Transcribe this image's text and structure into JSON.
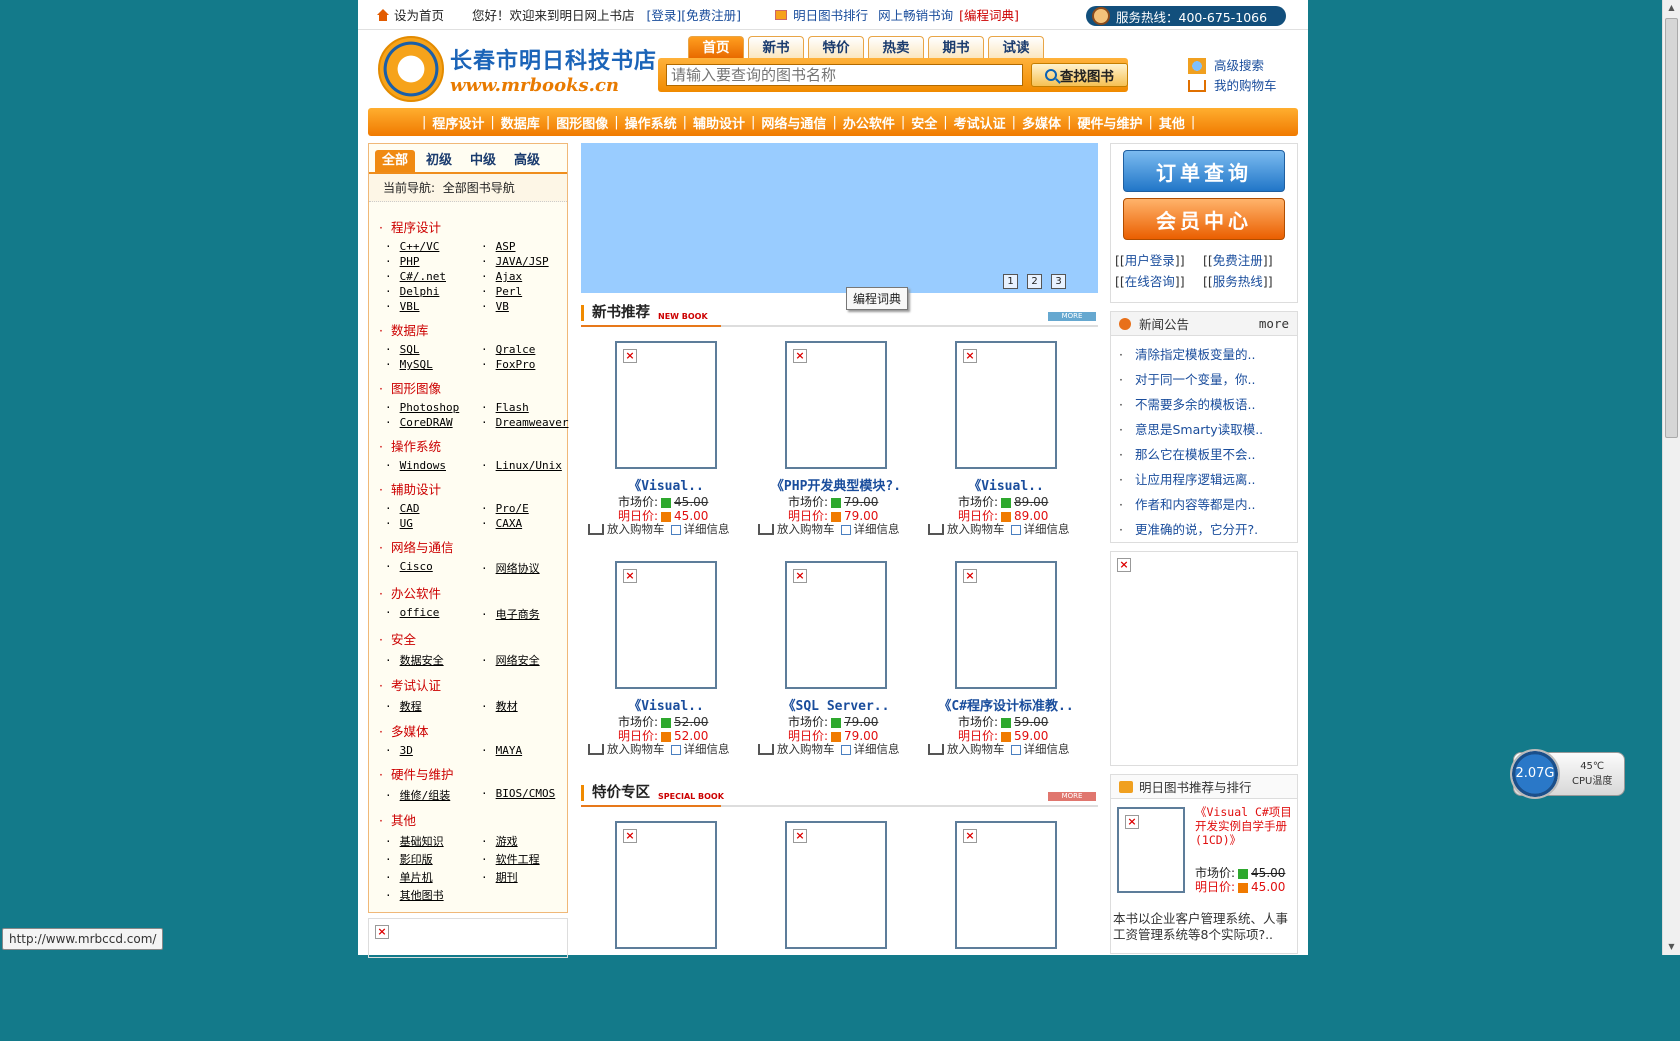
{
  "topbar": {
    "set_home": "设为首页",
    "welcome": "您好！欢迎来到明日网上书店",
    "login": "[登录]",
    "register": "[免费注册]",
    "ranking": "明日图书排行",
    "bestseller": "网上畅销书询",
    "dictionary": "[编程词典]",
    "hotline": "服务热线：400-675-1066"
  },
  "logo": {
    "name": "长春市明日科技书店",
    "url": "www.mrbooks.cn"
  },
  "nav_tabs": [
    "首页",
    "新书",
    "特价",
    "热卖",
    "期书",
    "试读"
  ],
  "search": {
    "placeholder": "请输入要查询的图书名称",
    "button": "查找图书"
  },
  "head_links": {
    "advanced": "高级搜索",
    "cart": "我的购物车"
  },
  "categories_bar": [
    "程序设计",
    "数据库",
    "图形图像",
    "操作系统",
    "辅助设计",
    "网络与通信",
    "办公软件",
    "安全",
    "考试认证",
    "多媒体",
    "硬件与维护",
    "其他"
  ],
  "left": {
    "levels": [
      "全部",
      "初级",
      "中级",
      "高级"
    ],
    "crumb_label": "当前导航:",
    "crumb_value": "全部图书导航",
    "groups": [
      {
        "name": "程序设计",
        "items": [
          "C++/VC",
          "ASP",
          "PHP",
          "JAVA/JSP",
          "C#/.net",
          "Ajax",
          "Delphi",
          "Perl",
          "VBL",
          "VB"
        ]
      },
      {
        "name": "数据库",
        "items": [
          "SQL",
          "Qralce",
          "MySQL",
          "FoxPro"
        ]
      },
      {
        "name": "图形图像",
        "items": [
          "Photoshop",
          "Flash",
          "CoreDRAW",
          "Dreamweaver"
        ]
      },
      {
        "name": "操作系统",
        "items": [
          "Windows",
          "Linux/Unix"
        ]
      },
      {
        "name": "辅助设计",
        "items": [
          "CAD",
          "Pro/E",
          "UG",
          "CAXA"
        ]
      },
      {
        "name": "网络与通信",
        "items": [
          "Cisco",
          "网络协议"
        ]
      },
      {
        "name": "办公软件",
        "items": [
          "office",
          "电子商务"
        ]
      },
      {
        "name": "安全",
        "items": [
          "数据安全",
          "网络安全"
        ]
      },
      {
        "name": "考试认证",
        "items": [
          "教程",
          "教材"
        ]
      },
      {
        "name": "多媒体",
        "items": [
          "3D",
          "MAYA"
        ]
      },
      {
        "name": "硬件与维护",
        "items": [
          "维修/组装",
          "BIOS/CMOS"
        ]
      },
      {
        "name": "其他",
        "items": [
          "基础知识",
          "游戏",
          "影印版",
          "软件工程",
          "单片机",
          "期刊",
          "其他图书"
        ]
      }
    ]
  },
  "banner": {
    "pages": [
      "1",
      "2",
      "3"
    ],
    "tooltip": "编程词典"
  },
  "new_books": {
    "title": "新书推荐",
    "subtitle": "NEW BOOK",
    "more": "MORE",
    "market_label": "市场价:",
    "our_label": "明日价:",
    "add_cart": "放入购物车",
    "detail": "详细信息",
    "books": [
      {
        "title": "《Visual..",
        "market": "45.00",
        "price": "45.00"
      },
      {
        "title": "《PHP开发典型模块?.",
        "market": "79.00",
        "price": "79.00"
      },
      {
        "title": "《Visual..",
        "market": "89.00",
        "price": "89.00"
      },
      {
        "title": "《Visual..",
        "market": "52.00",
        "price": "52.00"
      },
      {
        "title": "《SQL Server..",
        "market": "79.00",
        "price": "79.00"
      },
      {
        "title": "《C#程序设计标准教..",
        "market": "59.00",
        "price": "59.00"
      }
    ]
  },
  "special": {
    "title": "特价专区",
    "subtitle": "SPECIAL BOOK",
    "more": "MORE"
  },
  "right": {
    "order_query": "订单查询",
    "member_center": "会员中心",
    "links": [
      "用户登录",
      "免费注册",
      "在线咨询",
      "服务热线"
    ],
    "news_title": "新闻公告",
    "news_more": "more",
    "news": [
      "清除指定模板变量的..",
      "对于同一个变量，你..",
      "不需要多余的模板语..",
      "意思是Smarty读取模..",
      "那么它在模板里不会..",
      "让应用程序逻辑远离..",
      "作者和内容等都是内..",
      "更准确的说，它分开?."
    ],
    "rank_title": "明日图书推荐与排行",
    "rank_book": "《Visual C#项目开发实例自学手册(1CD)》",
    "rank_market_label": "市场价:",
    "rank_market": "45.00",
    "rank_our_label": "明日价:",
    "rank_price": "45.00",
    "rank_desc": "本书以企业客户管理系统、人事工资管理系统等8个实际项?.."
  },
  "status_url": "http://www.mrbccd.com/",
  "widget": {
    "value": "2.07G",
    "temp": "45℃",
    "label": "CPU温度"
  }
}
